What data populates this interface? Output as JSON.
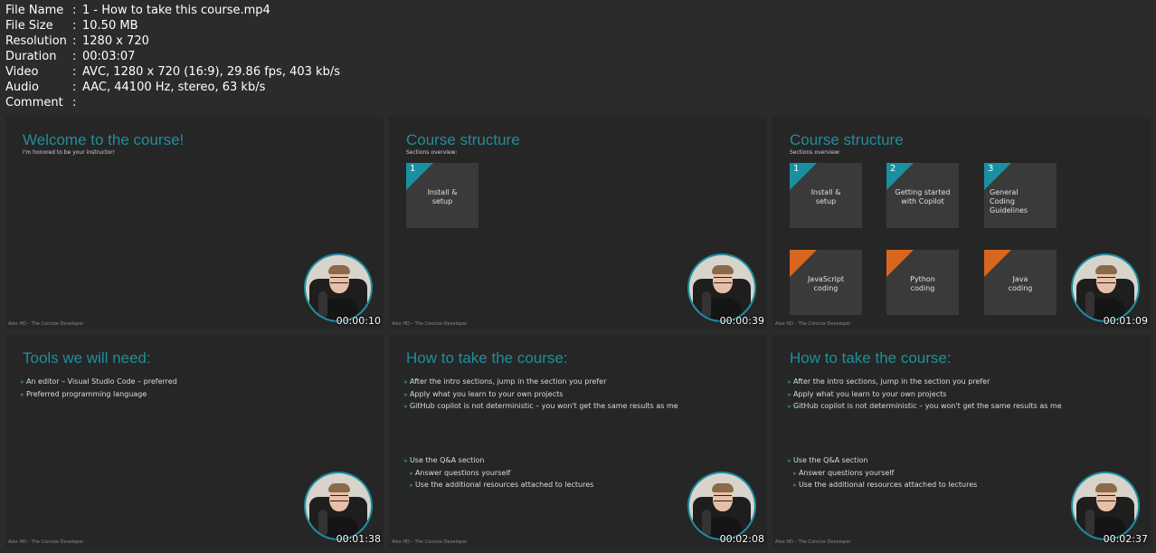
{
  "info": [
    {
      "label": "File Name",
      "value": "1 - How to take this course.mp4"
    },
    {
      "label": "File Size",
      "value": "10.50 MB"
    },
    {
      "label": "Resolution",
      "value": "1280 x 720"
    },
    {
      "label": "Duration",
      "value": "00:03:07"
    },
    {
      "label": "Video",
      "value": "AVC, 1280 x 720 (16:9), 29.86 fps, 403 kb/s"
    },
    {
      "label": "Audio",
      "value": "AAC, 44100 Hz, stereo, 63 kb/s"
    },
    {
      "label": "Comment",
      "value": ""
    }
  ],
  "separator": ":",
  "footer": "Alex HD – The Concise Developer",
  "thumbs": [
    {
      "title": "Welcome to the course!",
      "subtitle": "I'm honored to be your instructor!",
      "time": "00:00:10"
    },
    {
      "title": "Course structure",
      "subtitle": "Sections overview:",
      "time": "00:00:39",
      "tiles": [
        {
          "num": "1",
          "label": "Install & setup"
        }
      ]
    },
    {
      "title": "Course structure",
      "subtitle": "Sections overview:",
      "time": "00:01:09",
      "tiles": [
        {
          "num": "1",
          "label": "Install & setup"
        },
        {
          "num": "2",
          "label": "Getting started with Copilot"
        },
        {
          "num": "3",
          "label": "General Coding Guidelines"
        },
        {
          "num": "",
          "label": "JavaScript coding"
        },
        {
          "num": "",
          "label": "Python coding"
        },
        {
          "num": "",
          "label": "Java coding"
        }
      ]
    },
    {
      "title": "Tools we will need:",
      "time": "00:01:38",
      "bullets": [
        "An editor – Visual Studio Code – preferred",
        "Preferred programming language"
      ]
    },
    {
      "title": "How to take the course:",
      "time": "00:02:08",
      "bullets": [
        "After the intro sections, jump in the section you prefer",
        "Apply what you learn to your own projects",
        "GitHub copilot is not deterministic – you won't get the same results as me"
      ],
      "bullets2": [
        "Use the Q&A section",
        "Answer questions yourself",
        "Use the additional resources attached to lectures"
      ]
    },
    {
      "title": "How to take the course:",
      "time": "00:02:37",
      "bullets": [
        "After the intro sections, jump in the section you prefer",
        "Apply what you learn to your own projects",
        "GitHub copilot is not deterministic – you won't get the same results as me"
      ],
      "bullets2": [
        "Use the Q&A section",
        "Answer questions yourself",
        "Use the additional resources attached to lectures"
      ]
    }
  ],
  "colors": {
    "accent": "#1a8fa0",
    "orange": "#d9661f",
    "background": "#2b2b2b",
    "slide": "#262626"
  }
}
